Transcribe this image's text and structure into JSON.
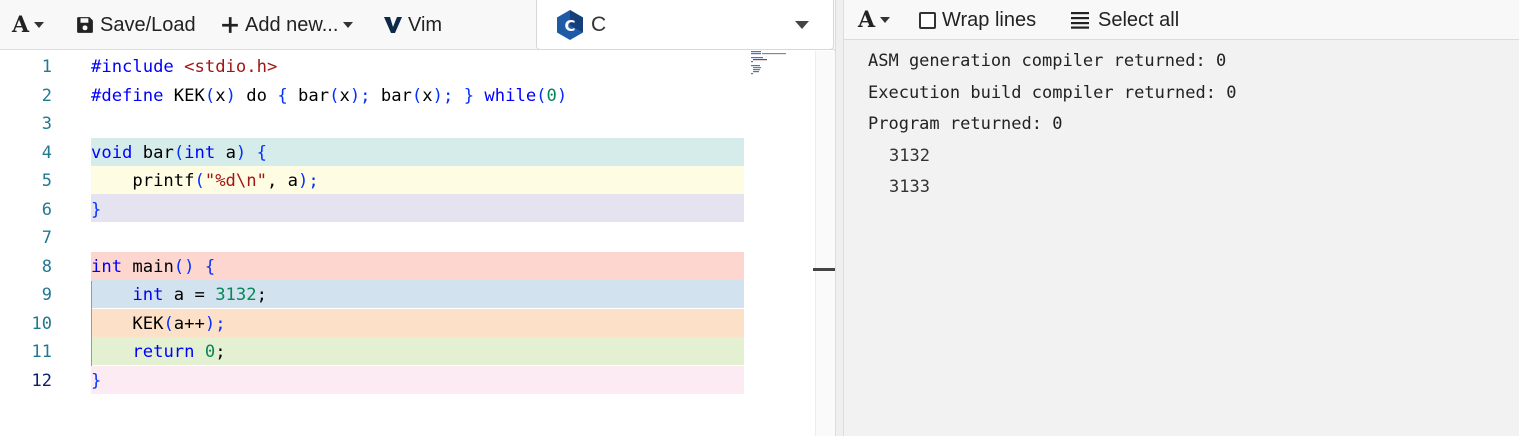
{
  "editor_toolbar": {
    "font_button": "A",
    "save_load_label": "Save/Load",
    "add_new_label": "Add new...",
    "vim_label": "Vim"
  },
  "language": {
    "selected": "C",
    "icon": "c-language-logo-icon",
    "logo_letter": "C"
  },
  "code_lines": [
    {
      "number": "1"
    },
    {
      "number": "2"
    },
    {
      "number": "3"
    },
    {
      "number": "4"
    },
    {
      "number": "5"
    },
    {
      "number": "6"
    },
    {
      "number": "7"
    },
    {
      "number": "8"
    },
    {
      "number": "9"
    },
    {
      "number": "10"
    },
    {
      "number": "11"
    },
    {
      "number": "12"
    }
  ],
  "code_tokens": {
    "l1": [
      "#include",
      " ",
      "<stdio.h>"
    ],
    "l2": [
      "#define",
      " KEK",
      "(",
      "x",
      ")",
      " do ",
      "{",
      " bar",
      "(",
      "x",
      ");",
      " bar",
      "(",
      "x",
      ");",
      " ",
      "}",
      " ",
      "while",
      "(",
      "0",
      ")"
    ],
    "l4": [
      "void",
      " bar",
      "(",
      "int",
      " a",
      ")",
      " ",
      "{"
    ],
    "l5": [
      "    printf",
      "(",
      "\"%d\\n\"",
      ", a",
      ");"
    ],
    "l6": [
      "}"
    ],
    "l8": [
      "int",
      " main",
      "()",
      " ",
      "{"
    ],
    "l9": [
      "    ",
      "int",
      " a = ",
      "3132",
      ";"
    ],
    "l10": [
      "    KEK",
      "(",
      "a++",
      ");"
    ],
    "l11": [
      "    ",
      "return",
      " ",
      "0",
      ";"
    ],
    "l12": [
      "}"
    ]
  },
  "line_highlight_colors": {
    "4": "#d6ecea",
    "5": "#fefde3",
    "6": "#e5e3f0",
    "8": "#fdd6d0",
    "9": "#d2e2ef",
    "10": "#fde0c8",
    "11": "#e3f0d2",
    "12": "#fcebf3"
  },
  "output_toolbar": {
    "font_button": "A",
    "wrap_lines_label": "Wrap lines",
    "wrap_lines_checked": false,
    "select_all_label": "Select all"
  },
  "output": {
    "asm_status": "ASM generation compiler returned: 0",
    "build_status": "Execution build compiler returned: 0",
    "program_status": "Program returned: 0",
    "stdout": [
      "3132",
      "3133"
    ]
  }
}
